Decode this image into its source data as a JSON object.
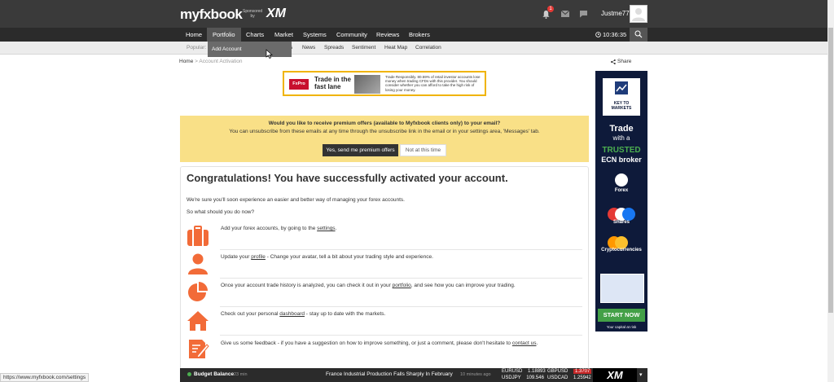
{
  "brand": {
    "logo": "myfxbook",
    "sponsor_line1": "Sponsored",
    "sponsor_line2": "by",
    "sponsor_brand": "XM"
  },
  "user": {
    "name": "Justme77",
    "notifications": "1"
  },
  "nav": {
    "items": [
      "Home",
      "Portfolio",
      "Charts",
      "Market",
      "Systems",
      "Community",
      "Reviews",
      "Brokers"
    ],
    "time": "10:36:35"
  },
  "subnav": {
    "label": "Popular:",
    "items": [
      "News",
      "Spreads",
      "Sentiment",
      "Heat Map",
      "Correlation"
    ],
    "dropdown_item": "Add Account"
  },
  "breadcrumb": {
    "home": "Home",
    "sep": ">",
    "current": "Account Activation"
  },
  "share": "Share",
  "top_ad": {
    "brand": "FxPro",
    "headline1": "Trade in the",
    "headline2": "fast lane",
    "fine": "Trade Responsibly. 80.59% of retail investor accounts lose money when trading CFDs with this provider. You should consider whether you can afford to take the high risk of losing your money."
  },
  "offer": {
    "question": "Would you like to receive premium offers (available to Myfxbook clients only) to your email?",
    "sub": "You can unsubscribe from these emails at any time through the unsubscribe link in the email or in your settings area, 'Messages' tab.",
    "yes": "Yes, send me premium offers",
    "no": "Not at this time"
  },
  "card": {
    "title": "Congratulations! You have successfully activated your account.",
    "p1": "We're sure you'll soon experience an easier and better way of managing your forex accounts.",
    "p2": "So what should you do now?",
    "steps": [
      {
        "icon": "briefcase-icon",
        "pre": "Add your forex accounts, by going to the ",
        "link": "settings",
        "post": "."
      },
      {
        "icon": "user-icon",
        "pre": "Update your ",
        "link": "profile",
        "post": " - Change your avatar, tell a bit about your trading style and experience."
      },
      {
        "icon": "pie-chart-icon",
        "pre": "Once your account trade history is analyzed, you can check it out in your ",
        "link": "portfolio",
        "post": ", and see how you can improve your trading."
      },
      {
        "icon": "home-icon",
        "pre": "Check out your personal ",
        "link": "dashboard",
        "post": " - stay up to date with the markets."
      },
      {
        "icon": "feedback-icon",
        "pre": "Give us some feedback - if you have a suggestion on how to improve something, or just a comment, please don't hesitate to ",
        "link": "contact us",
        "post": "."
      }
    ]
  },
  "side_ad": {
    "logo_line1": "KEY TO",
    "logo_line2": "MARKETS",
    "trade": "Trade",
    "with_a": "with a",
    "trusted": "TRUSTED",
    "ecn": "ECN broker",
    "forex": "Forex",
    "shares": "Shares",
    "crypto": "Cryptocurrencies",
    "start": "START NOW",
    "fine": "Your capital at risk"
  },
  "ticker": {
    "label": "Budget Balance",
    "label_time": "23 min",
    "headline": "France Industrial Production Falls Sharply In February",
    "headline_time": "10 minutes ago",
    "pair1": "EURUSD",
    "val1": "1.18893",
    "pair2": "GBPUSD",
    "val2": "1.3707",
    "pair3": "USDJPY",
    "val3": "109.546",
    "pair4": "USDCAD",
    "val4": "1.25942",
    "xm": "XM"
  },
  "statusbar": "https://www.myfxbook.com/settings",
  "colors": {
    "accent_orange": "#f26b38",
    "offer_bg": "#f9e087",
    "nav_bg": "#2b2b2b",
    "topbar_bg": "#3a3a3a"
  }
}
